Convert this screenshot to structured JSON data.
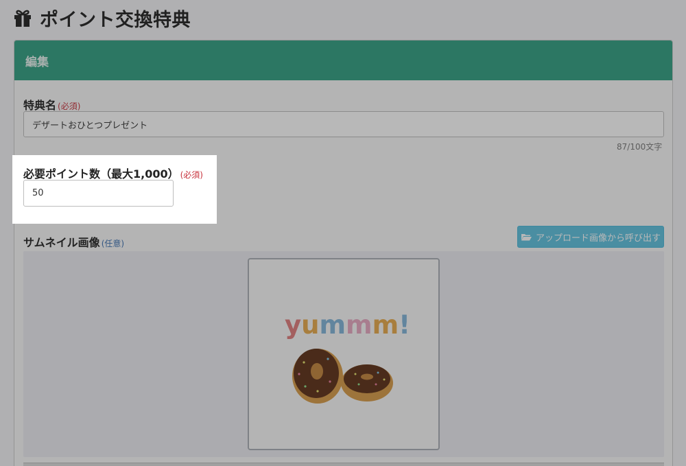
{
  "page": {
    "title": "ポイント交換特典",
    "title_icon": "gift-icon"
  },
  "panel": {
    "header": "編集"
  },
  "fields": {
    "name": {
      "label": "特典名",
      "required": "(必須)",
      "value": "デザートおひとつプレゼント",
      "counter": "87/100文字"
    },
    "points": {
      "label": "必要ポイント数（最大1,000）",
      "required": "(必須)",
      "value": "50"
    },
    "thumbnail": {
      "label": "サムネイル画像",
      "optional": "(任意)",
      "upload_button": "アップロード画像から呼び出す",
      "upload_icon": "folder-open-icon",
      "image_text": "yummm!"
    }
  },
  "colors": {
    "header_bg": "#2f9f80",
    "upload_button_bg": "#5bc0de",
    "required": "#c7303a",
    "optional": "#3a6fb0"
  }
}
